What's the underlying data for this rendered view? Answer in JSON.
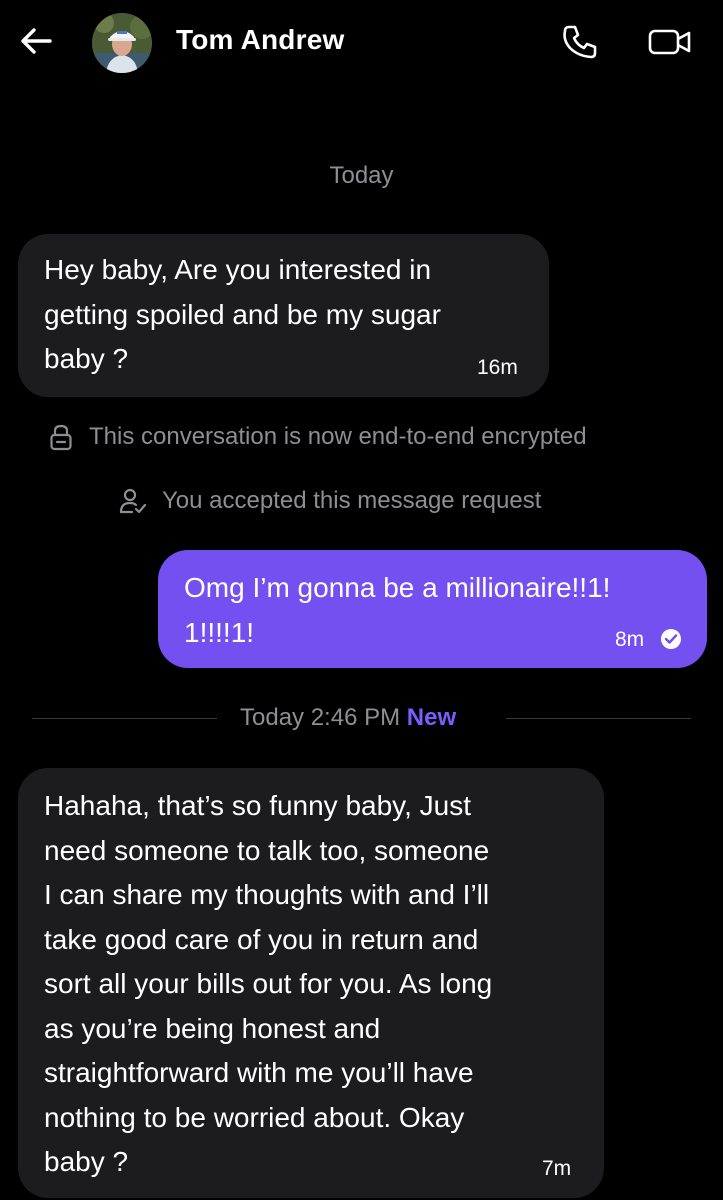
{
  "header": {
    "contact_name": "Tom Andrew",
    "back_icon": "arrow-left-icon",
    "call_icon": "phone-icon",
    "video_icon": "video-camera-icon"
  },
  "conversation": {
    "date_separator": "Today",
    "messages": [
      {
        "direction": "incoming",
        "lines": [
          "Hey baby, Are you interested in",
          "getting spoiled and be my sugar",
          "baby ?"
        ],
        "time": "16m"
      },
      {
        "direction": "outgoing",
        "lines": [
          "Omg I’m gonna be a millionaire!!1!",
          "1!!!!1!"
        ],
        "time": "8m",
        "status_icon": "check-circle-icon"
      },
      {
        "direction": "incoming",
        "lines": [
          "Hahaha, that’s so funny baby, Just",
          "need someone to talk too, someone",
          "I can share my thoughts with and I’ll",
          "take good care of you in return and",
          "sort all your bills out for you. As long",
          "as you’re being honest and",
          "straightforward with me you’ll have",
          "nothing to be worried about. Okay",
          "baby ?"
        ],
        "time": "7m"
      }
    ],
    "encryption_notice": "This conversation is now end-to-end encrypted",
    "request_notice": "You accepted this message request",
    "new_separator": {
      "time": "Today 2:46 PM",
      "badge": "New"
    }
  },
  "colors": {
    "background": "#000000",
    "incoming_bubble": "#1c1c1e",
    "outgoing_bubble": "#7450f0",
    "muted_text": "#8e8e93",
    "new_badge": "#7c5cff"
  }
}
